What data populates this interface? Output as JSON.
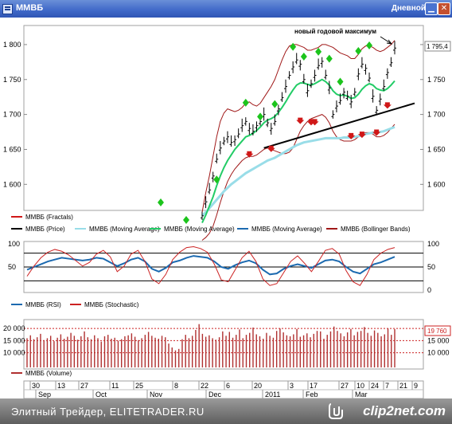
{
  "window": {
    "title": "ММВБ",
    "period_label": "Дневной",
    "icons": {
      "app": "chart-window-icon",
      "minimize": "minimize-icon",
      "close": "close-icon"
    }
  },
  "annotation": "новый годовой максимум",
  "price_label": "1 795,4",
  "volume_label": "19 760",
  "legends": {
    "price": [
      "ММВБ (Fractals)",
      "ММВБ (Price)",
      "ММВБ (Moving Average)",
      "ММВБ (Moving Average)",
      "ММВБ (Moving Average)",
      "ММВБ (Bollinger Bands)"
    ],
    "oscillators": [
      "ММВБ (RSI)",
      "ММВБ (Stochastic)"
    ],
    "volume": [
      "ММВБ (Volume)"
    ]
  },
  "colors": {
    "price": "#000000",
    "fractal_up": "#1cc41c",
    "fractal_down": "#d01818",
    "bollinger": "#a01818",
    "ma_fast": "#22cc66",
    "ma_slow": "#66ddee",
    "ma_light": "#99dde8",
    "rsi": "#1c6ab0",
    "stochastic": "#cc2222",
    "volume": "#b03030",
    "trendline": "#000000"
  },
  "footer": {
    "left": "Элитный Трейдер, ELITETRADER.RU",
    "logo": "clip2net.com"
  },
  "chart_data": [
    {
      "type": "line",
      "name": "price",
      "ylim": [
        1565,
        1825
      ],
      "yticks": [
        "1 800",
        "1 750",
        "1 700",
        "1 650",
        "1 600"
      ],
      "ytick_values": [
        1800,
        1750,
        1700,
        1650,
        1600
      ],
      "series": [
        {
          "name": "ММВБ (Price)",
          "values": [
            1555,
            1575,
            1592,
            1612,
            1636,
            1652,
            1662,
            1668,
            1660,
            1664,
            1672,
            1684,
            1690,
            1680,
            1676,
            1684,
            1690,
            1700,
            1688,
            1680,
            1690,
            1708,
            1724,
            1740,
            1756,
            1768,
            1778,
            1772,
            1750,
            1734,
            1744,
            1756,
            1770,
            1776,
            1756,
            1738,
            1700,
            1712,
            1720,
            1732,
            1726,
            1718,
            1732,
            1758,
            1772,
            1766,
            1752,
            1726,
            1706,
            1722,
            1740,
            1760,
            1774,
            1795
          ]
        },
        {
          "name": "ММВБ (Moving Average)",
          "values": [
            1545,
            1556,
            1569,
            1582,
            1598,
            1612,
            1624,
            1634,
            1642,
            1650,
            1656,
            1662,
            1668,
            1670,
            1673,
            1677,
            1682,
            1688,
            1692,
            1694,
            1697,
            1703,
            1710,
            1718,
            1727,
            1735,
            1742,
            1745,
            1745,
            1743,
            1742,
            1744,
            1747,
            1750,
            1747,
            1742,
            1734,
            1729,
            1727,
            1728,
            1726,
            1723,
            1724,
            1729,
            1736,
            1741,
            1744,
            1742,
            1737,
            1735,
            1734,
            1737,
            1742,
            1748
          ]
        },
        {
          "name": "ММВБ (Moving Average)",
          "values": [
            1555,
            1560,
            1566,
            1572,
            1578,
            1584,
            1590,
            1595,
            1600,
            1604,
            1608,
            1612,
            1616,
            1619,
            1622,
            1625,
            1628,
            1631,
            1634,
            1636,
            1638,
            1641,
            1644,
            1647,
            1650,
            1653,
            1656,
            1658,
            1660,
            1661,
            1662,
            1663,
            1664,
            1665,
            1666,
            1666,
            1666,
            1666,
            1666,
            1667,
            1667,
            1667,
            1668,
            1669,
            1670,
            1672,
            1673,
            1674,
            1674,
            1675,
            1676,
            1678,
            1680,
            1682
          ]
        }
      ],
      "bollinger_upper": [
        1560,
        1588,
        1612,
        1640,
        1668,
        1690,
        1702,
        1708,
        1706,
        1704,
        1706,
        1710,
        1716,
        1718,
        1714,
        1712,
        1716,
        1724,
        1732,
        1740,
        1750,
        1764,
        1778,
        1790,
        1798,
        1800,
        1800,
        1798,
        1796,
        1792,
        1792,
        1794,
        1796,
        1800,
        1800,
        1798,
        1796,
        1792,
        1788,
        1786,
        1784,
        1780,
        1780,
        1786,
        1794,
        1798,
        1798,
        1796,
        1792,
        1790,
        1792,
        1796,
        1800,
        1806
      ],
      "bollinger_lower": [
        1520,
        1524,
        1530,
        1540,
        1556,
        1574,
        1590,
        1604,
        1614,
        1622,
        1628,
        1634,
        1638,
        1640,
        1640,
        1642,
        1646,
        1650,
        1652,
        1650,
        1648,
        1646,
        1644,
        1644,
        1646,
        1652,
        1664,
        1676,
        1684,
        1690,
        1694,
        1696,
        1698,
        1700,
        1696,
        1688,
        1676,
        1668,
        1664,
        1662,
        1662,
        1662,
        1664,
        1668,
        1672,
        1674,
        1674,
        1672,
        1668,
        1668,
        1670,
        1674,
        1680,
        1686
      ],
      "fractals_up": [
        [
          4,
          1600
        ],
        [
          12,
          1710
        ],
        [
          16,
          1690
        ],
        [
          20,
          1708
        ],
        [
          25,
          1790
        ],
        [
          28,
          1776
        ],
        [
          32,
          1783
        ],
        [
          35,
          1773
        ],
        [
          38,
          1740
        ],
        [
          43,
          1784
        ],
        [
          46,
          1792
        ]
      ],
      "fractals_down": [
        [
          13,
          1652
        ],
        [
          19,
          1660
        ],
        [
          27,
          1700
        ],
        [
          30,
          1698
        ],
        [
          31,
          1698
        ],
        [
          41,
          1678
        ],
        [
          44,
          1680
        ],
        [
          48,
          1683
        ],
        [
          51,
          1722
        ]
      ],
      "trendline": [
        [
          17,
          1652
        ],
        [
          53,
          1710
        ]
      ]
    },
    {
      "type": "line",
      "name": "oscillators",
      "ylim": [
        0,
        100
      ],
      "yticks": [
        "100",
        "50",
        "0"
      ],
      "left_ticks": [
        "100",
        "50"
      ],
      "levels": [
        80,
        50,
        20
      ],
      "series": [
        {
          "name": "ММВБ (RSI)",
          "values": [
            44,
            50,
            56,
            62,
            66,
            70,
            68,
            66,
            64,
            66,
            70,
            68,
            60,
            52,
            58,
            66,
            70,
            62,
            46,
            40,
            48,
            60,
            64,
            70,
            74,
            72,
            70,
            62,
            50,
            46,
            54,
            60,
            64,
            58,
            44,
            34,
            36,
            46,
            52,
            56,
            52,
            48,
            56,
            64,
            66,
            62,
            50,
            40,
            36,
            46,
            56,
            60,
            66,
            72
          ]
        },
        {
          "name": "ММВБ (Stochastic)",
          "values": [
            30,
            52,
            70,
            82,
            88,
            84,
            76,
            64,
            52,
            60,
            78,
            86,
            72,
            40,
            52,
            78,
            86,
            62,
            24,
            14,
            34,
            66,
            82,
            92,
            94,
            90,
            82,
            56,
            22,
            18,
            44,
            70,
            84,
            62,
            24,
            10,
            14,
            38,
            62,
            74,
            58,
            40,
            62,
            86,
            90,
            78,
            42,
            18,
            10,
            34,
            66,
            80,
            88,
            92
          ]
        }
      ]
    },
    {
      "type": "bar",
      "name": "volume",
      "ylim": [
        4000,
        23000
      ],
      "yticks": [
        "20 000",
        "15 000",
        "10 000"
      ],
      "ytick_values": [
        20000,
        15000,
        10000
      ],
      "values": [
        16000,
        17200,
        15600,
        16400,
        17800,
        15200,
        16000,
        17000,
        14800,
        16200,
        17600,
        15800,
        16600,
        18200,
        17000,
        15400,
        16800,
        18800,
        16400,
        15600,
        17200,
        16000,
        14600,
        16800,
        17400,
        15800,
        16200,
        15000,
        15600,
        16800,
        17200,
        18000,
        16600,
        15200,
        16000,
        17400,
        18600,
        17000,
        16200,
        15800,
        17000,
        16400,
        13800,
        12200,
        11000,
        11600,
        15600,
        17400,
        16000,
        17000,
        19400,
        21800,
        17800,
        16600,
        17200,
        16000,
        15400,
        16400,
        18800,
        17000,
        18600,
        16200,
        17400,
        19600,
        16000,
        17400,
        18200,
        20400,
        17600,
        16800,
        15800,
        18200,
        17000,
        16200,
        19000,
        20000,
        18400,
        17200,
        16800,
        17600,
        19800,
        16600,
        17200,
        18000,
        16400,
        17800,
        19000,
        18800,
        15800,
        17400,
        18800,
        20800,
        19000,
        18000,
        16800,
        18400,
        19800,
        17200,
        18600,
        19000,
        20600,
        18200,
        17000,
        19200,
        18200,
        16800,
        17600,
        20000,
        17400,
        19760
      ],
      "dashed_gridlines": [
        20000,
        15000,
        10000
      ]
    },
    {
      "type": "table",
      "name": "time_axis",
      "day_labels": [
        "30",
        "13",
        "27",
        "11",
        "25",
        "8",
        "22",
        "6",
        "20",
        "3",
        "17",
        "27",
        "10",
        "24",
        "7",
        "21",
        "9"
      ],
      "month_labels": [
        "Sep",
        "Oct",
        "Nov",
        "Dec",
        "2011",
        "Feb",
        "Mar"
      ]
    }
  ]
}
